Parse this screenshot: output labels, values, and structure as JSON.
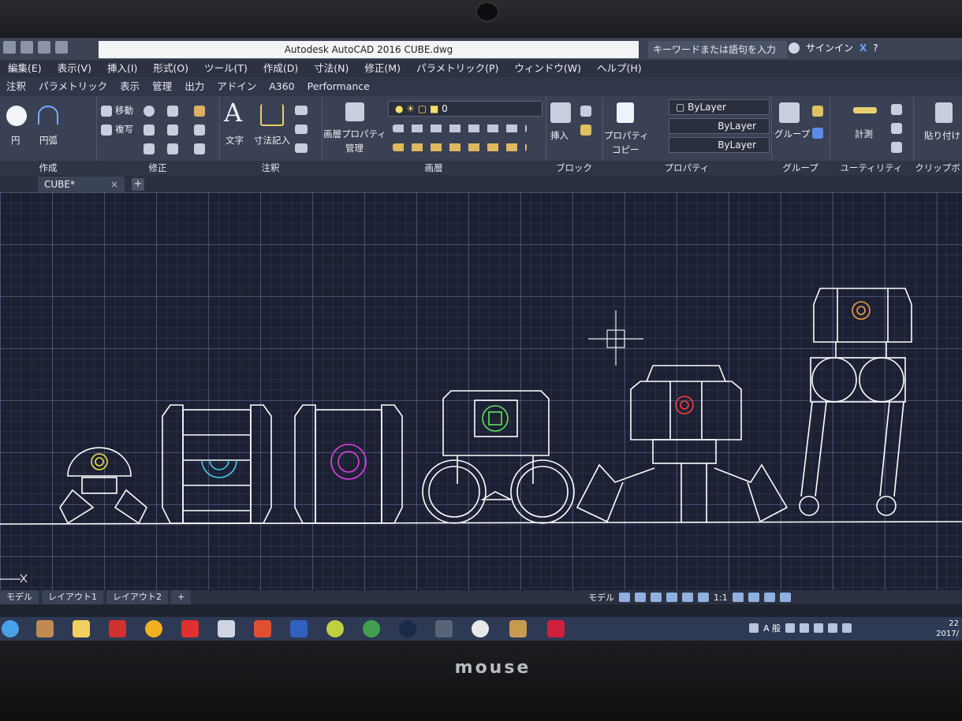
{
  "title": "Autodesk AutoCAD 2016    CUBE.dwg",
  "search_placeholder": "キーワードまたは語句を入力",
  "signin_label": "サインイン",
  "menu": [
    "編集(E)",
    "表示(V)",
    "挿入(I)",
    "形式(O)",
    "ツール(T)",
    "作成(D)",
    "寸法(N)",
    "修正(M)",
    "パラメトリック(P)",
    "ウィンドウ(W)",
    "ヘルプ(H)"
  ],
  "ribbon_tabs": [
    "注釈",
    "パラメトリック",
    "表示",
    "管理",
    "出力",
    "アドイン",
    "A360",
    "Performance"
  ],
  "ribbon": {
    "draw": {
      "circle": "円",
      "arc": "円弧",
      "label": "作成"
    },
    "modify": {
      "move": "移動",
      "copy": "複写",
      "label": "修正"
    },
    "annotation": {
      "text": "文字",
      "dimension": "寸法記入",
      "label": "注釈"
    },
    "layers": {
      "layer_props_1": "画層プロパティ",
      "layer_props_2": "管理",
      "current_layer": "0",
      "label": "画層"
    },
    "block": {
      "insert": "挿入",
      "label": "ブロック"
    },
    "properties": {
      "match_1": "プロパティ",
      "match_2": "コピー",
      "color": "ByLayer",
      "linetype": "ByLayer",
      "lineweight": "ByLayer",
      "label": "プロパティ"
    },
    "groups": {
      "group": "グループ",
      "label": "グループ"
    },
    "utilities": {
      "measure": "計測",
      "label": "ユーティリティ"
    },
    "clipboard": {
      "paste": "貼り付け",
      "label": "クリップボ"
    }
  },
  "doc_tab": "CUBE*",
  "layout_tabs": [
    "モデル",
    "レイアウト1",
    "レイアウト2"
  ],
  "status": {
    "model": "モデル",
    "scale": "1:1"
  },
  "tray_ime": "A 般",
  "clock": {
    "time": "22",
    "date": "2017/"
  },
  "laptop_brand": "mouse",
  "colors": {
    "accent_yellow": "#f0e040",
    "accent_cyan": "#40c8e8",
    "accent_magenta": "#e040e0",
    "accent_green": "#60e060",
    "accent_red": "#ff3b3b",
    "accent_orange": "#f0a040"
  }
}
